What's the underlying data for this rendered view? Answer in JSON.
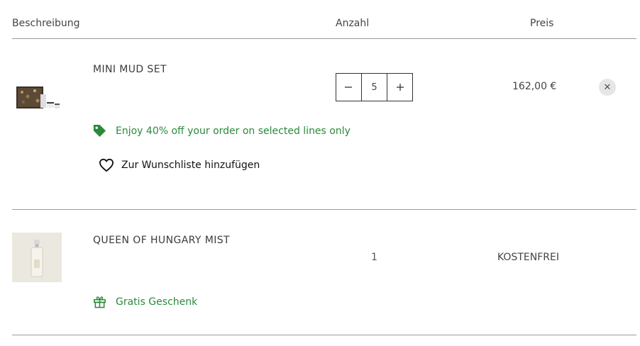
{
  "header": {
    "description": "Beschreibung",
    "quantity": "Anzahl",
    "price": "Preis"
  },
  "items": [
    {
      "name": "MINI MUD SET",
      "quantity": "5",
      "price": "162,00 €",
      "promo": "Enjoy 40% off your order on selected lines only",
      "wishlist": "Zur Wunschliste hinzufügen",
      "remove_icon": "close-icon",
      "thumb_icon": "gift-box-product-image"
    },
    {
      "name": "QUEEN OF HUNGARY MIST",
      "quantity": "1",
      "price": "KOSTENFREI",
      "promo": "Gratis Geschenk",
      "thumb_icon": "spray-bottle-product-image"
    }
  ],
  "colors": {
    "promo_green": "#2a8a3a",
    "rule": "#9a9a9a",
    "remove_bg": "#e6e6e6"
  }
}
